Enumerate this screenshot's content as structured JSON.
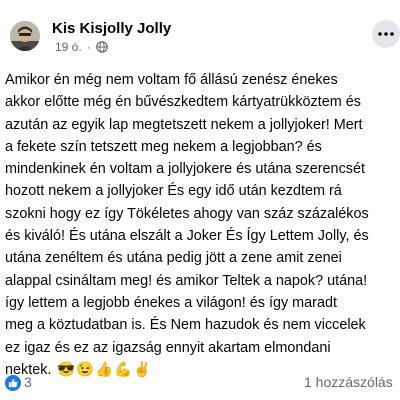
{
  "post": {
    "author": "Kis Kisjolly Jolly",
    "time": "19 ó.",
    "privacy_icon": "globe-icon",
    "more_icon": "more-options-icon",
    "lines": [
      "Amikor én még nem voltam fő állású zenész énekes",
      "akkor előtte még én bűvészkedtem kártyatrükköztem és",
      "azután az egyik lap megtetszett nekem a jollyjoker! Mert",
      "a fekete szín tetszett meg nekem a legjobban? és",
      "mindenkinek én voltam a jollyjokere és utána  szerencsét",
      "hozott nekem a jollyjoker És egy idő után kezdtem rá",
      "szokni hogy ez így Tökéletes ahogy van száz százalékos",
      "és kiváló! És utána elszált a Joker És Így Lettem Jolly, és",
      "utána  zenéltem és utána pedig jött a zene amit zenei",
      "alappal csináltam meg! és amikor Teltek a napok? utána!",
      "így lettem a legjobb  énekes a világon! és így maradt",
      "meg a köztudatban is. És Nem hazudok és nem viccelek",
      "ez igaz és ez az igazság  ennyit akartam elmondani",
      "nektek."
    ],
    "emojis": "😎😉👍💪✌️"
  },
  "footer": {
    "reaction_icon": "like-icon",
    "reaction_count": "3",
    "comments": "1 hozzászólás"
  },
  "colors": {
    "primary_text": "#050505",
    "secondary_text": "#65676b",
    "facebook_blue": "#1877f2",
    "button_bg": "#e4e6eb"
  }
}
